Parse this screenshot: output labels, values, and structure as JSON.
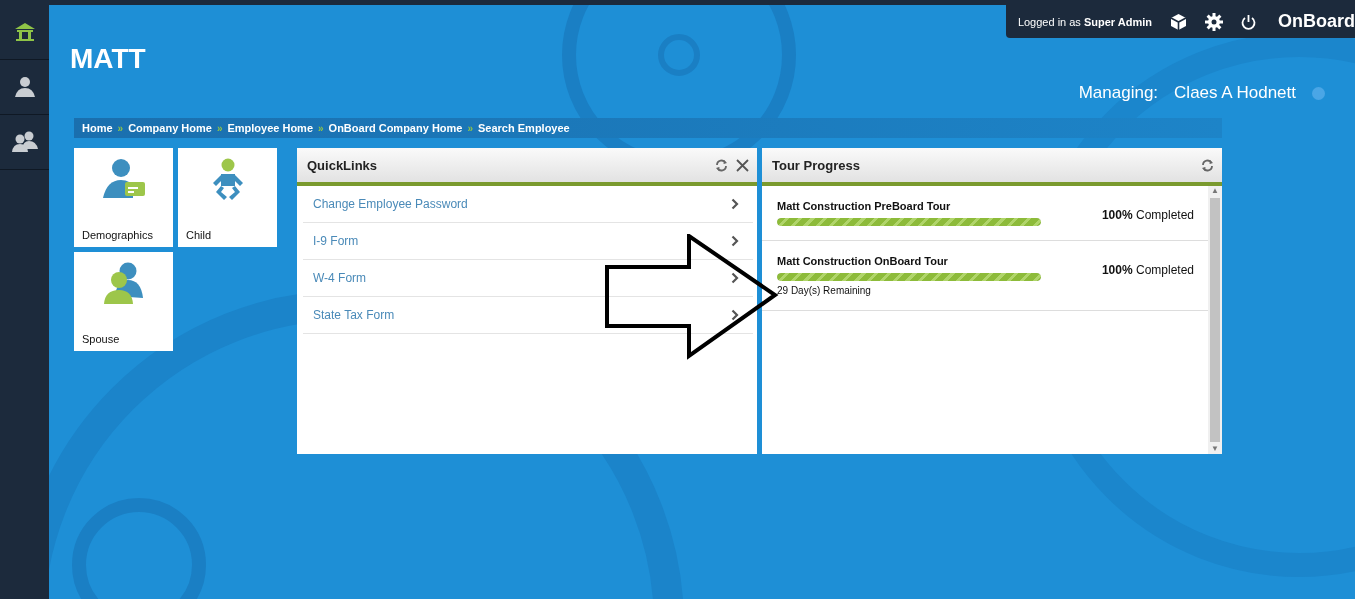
{
  "sidebar": {
    "items": [
      {
        "selected": true
      },
      {
        "selected": false
      },
      {
        "selected": false
      }
    ]
  },
  "topbar": {
    "login": "Logged in as **Super Admin**",
    "brand": "OnBoard"
  },
  "header": {
    "title": "MATT",
    "managing_label": "Managing:",
    "managing_name": "Claes A Hodnett"
  },
  "breadcrumb": {
    "separator": "»",
    "items": [
      "Home",
      "Company Home",
      "Employee Home",
      "OnBoard Company Home",
      "Search Employee"
    ]
  },
  "tiles": [
    {
      "label": "Demographics"
    },
    {
      "label": "Child"
    },
    {
      "label": "Spouse"
    }
  ],
  "quicklinks": {
    "title": "QuickLinks",
    "links": [
      "Change Employee Password",
      "I-9 Form",
      "W-4 Form",
      "State Tax Form"
    ]
  },
  "tour_progress": {
    "title": "Tour Progress",
    "scroll_up": "▲",
    "scroll_down": "▼",
    "tours": [
      {
        "name": "Matt Construction PreBoard Tour",
        "level": 1,
        "reading": "**100%** Completed"
      },
      {
        "name": "Matt Construction OnBoard Tour",
        "level": 1,
        "reading": "**100%** Completed",
        "remaining": "29 Day(s) Remaining"
      }
    ]
  }
}
